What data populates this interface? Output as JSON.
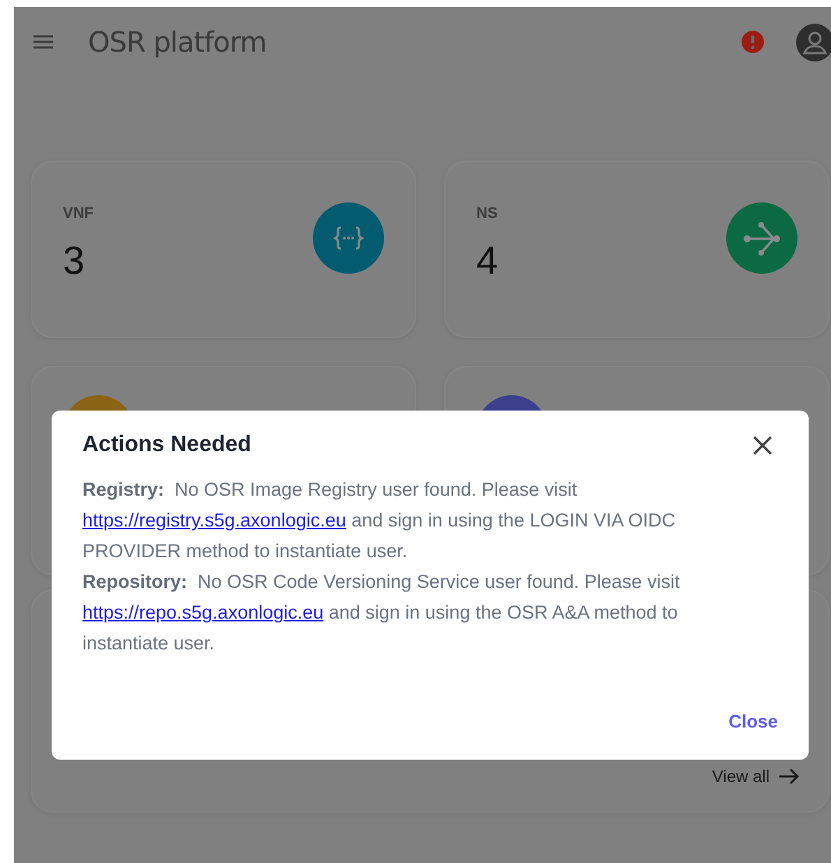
{
  "app_bar": {
    "title": "OSR platform"
  },
  "stat_cards": [
    {
      "label": "VNF",
      "value": "3",
      "kind": "braces",
      "color": "#035b70"
    },
    {
      "label": "NS",
      "value": "4",
      "kind": "share",
      "color": "#0b6a43"
    }
  ],
  "hidden_cards": [
    {
      "color": "#8a6414"
    },
    {
      "color": "#3b3f8c"
    }
  ],
  "list_card": {
    "link": "View all"
  },
  "dialog": {
    "title": "Actions Needed",
    "messages": [
      {
        "label": "Registry:",
        "text": "No OSR Image Registry user found. Please visit",
        "link": "https://registry.s5g.axonlogic.eu",
        "after": "and sign in using the LOGIN VIA OIDC PROVIDER method to instantiate user."
      },
      {
        "label": "Repository:",
        "text": "No OSR Code Versioning Service user found. Please visit",
        "link": "https://repo.s5g.axonlogic.eu",
        "after": "and sign in using the OSR A&A method to instantiate user."
      }
    ],
    "close_button": "Close"
  }
}
